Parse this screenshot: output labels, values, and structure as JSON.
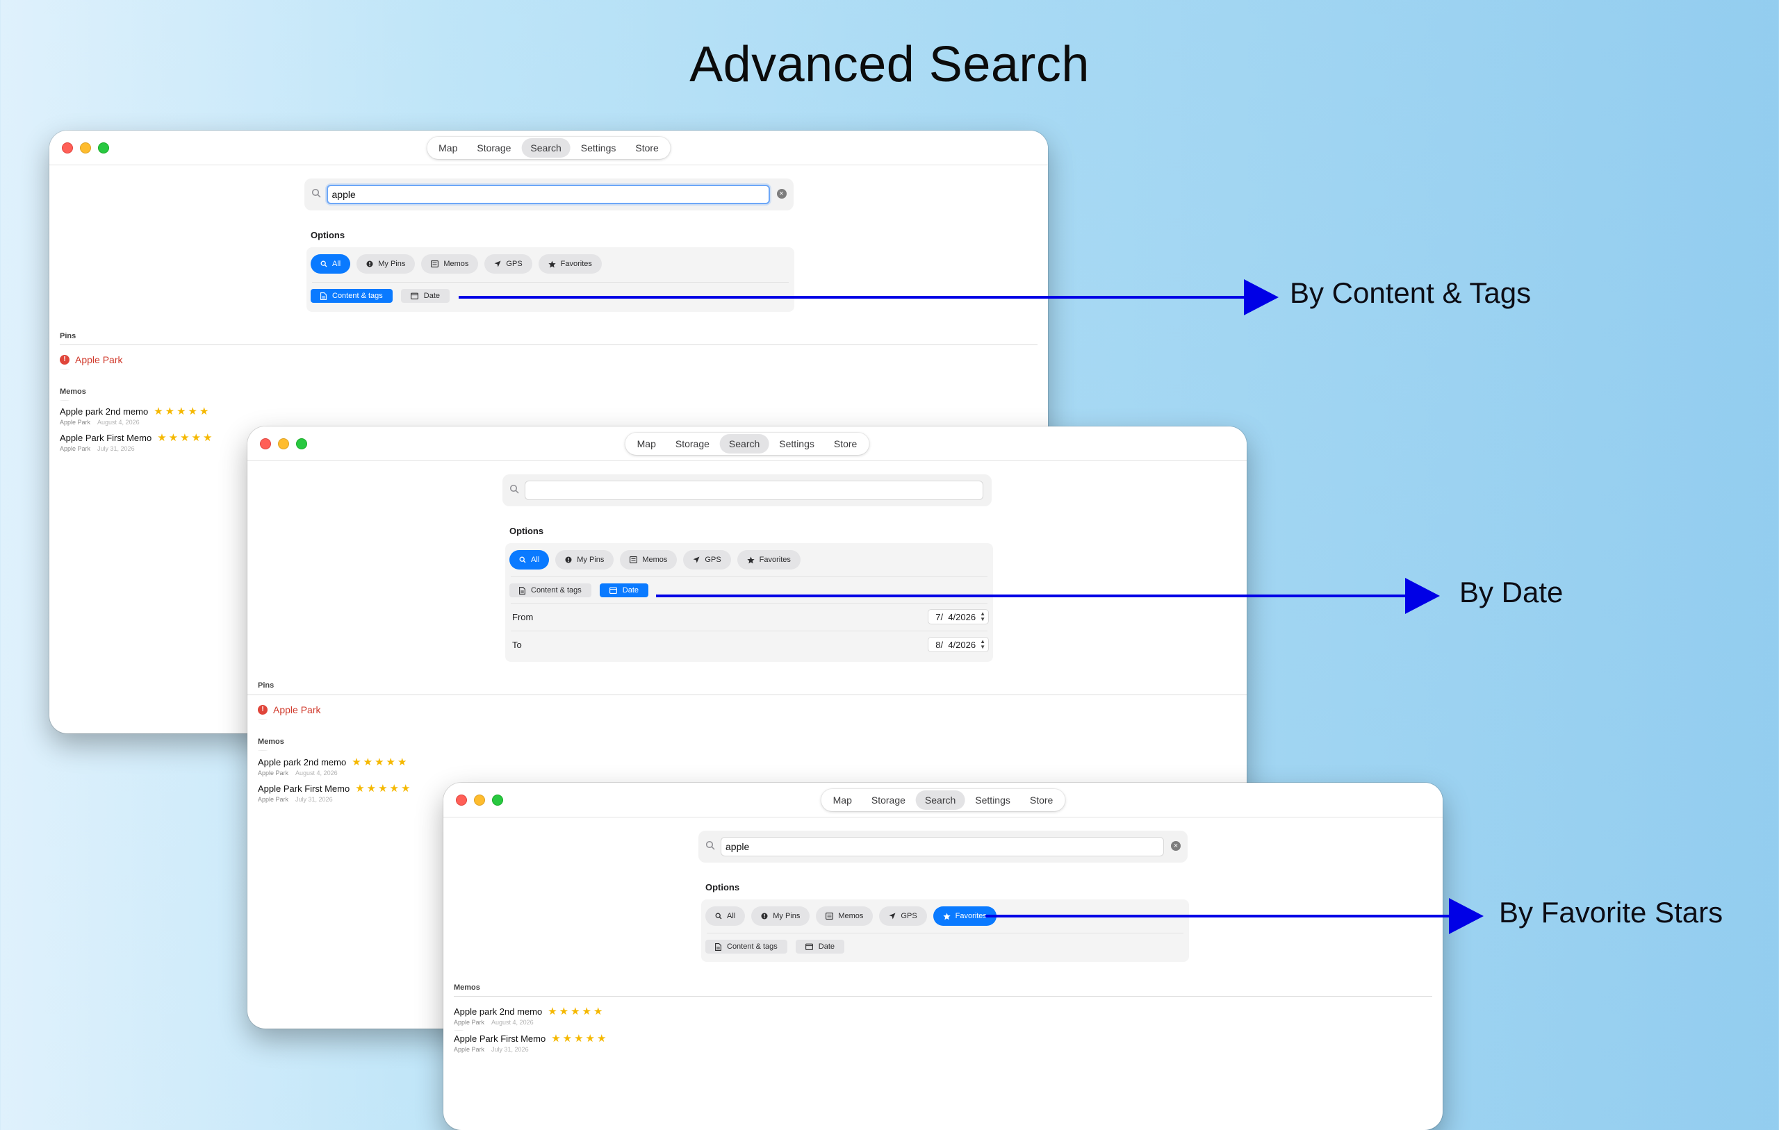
{
  "title": "Advanced Search",
  "tabs": [
    "Map",
    "Storage",
    "Search",
    "Settings",
    "Store"
  ],
  "filters": [
    "All",
    "My Pins",
    "Memos",
    "GPS",
    "Favorites"
  ],
  "scopes": [
    "Content & tags",
    "Date"
  ],
  "options_label": "Options",
  "sections": {
    "pins": "Pins",
    "memos": "Memos"
  },
  "pin_result": "Apple Park",
  "memos": [
    {
      "title": "Apple park 2nd memo",
      "location": "Apple Park",
      "date": "August 4, 2026",
      "stars": "★★★★★"
    },
    {
      "title": "Apple Park First Memo",
      "location": "Apple Park",
      "date": "July 31, 2026",
      "stars": "★★★★★"
    }
  ],
  "date_filter": {
    "from_label": "From",
    "from_value": "7/  4/2026",
    "to_label": "To",
    "to_value": "8/  4/2026"
  },
  "windows": [
    {
      "id": "content-tags",
      "search_value": "apple",
      "active_filter": "All",
      "active_scope": "Content & tags"
    },
    {
      "id": "date",
      "search_value": "",
      "active_filter": "All",
      "active_scope": "Date"
    },
    {
      "id": "favorites",
      "search_value": "apple",
      "active_filter": "Favorites",
      "active_scope": ""
    }
  ],
  "callouts": {
    "content_tags": "By Content & Tags",
    "date": "By Date",
    "favorites": "By Favorite Stars"
  },
  "colors": {
    "accent": "#0a7aff",
    "arrow": "#0000e6",
    "pin": "#d0392b",
    "stars": "#f5b800"
  },
  "icons": {
    "All": "search-icon",
    "My Pins": "pin-icon",
    "Memos": "memo-icon",
    "GPS": "location-arrow-icon",
    "Favorites": "star-icon",
    "Content & tags": "document-icon",
    "Date": "calendar-icon"
  }
}
